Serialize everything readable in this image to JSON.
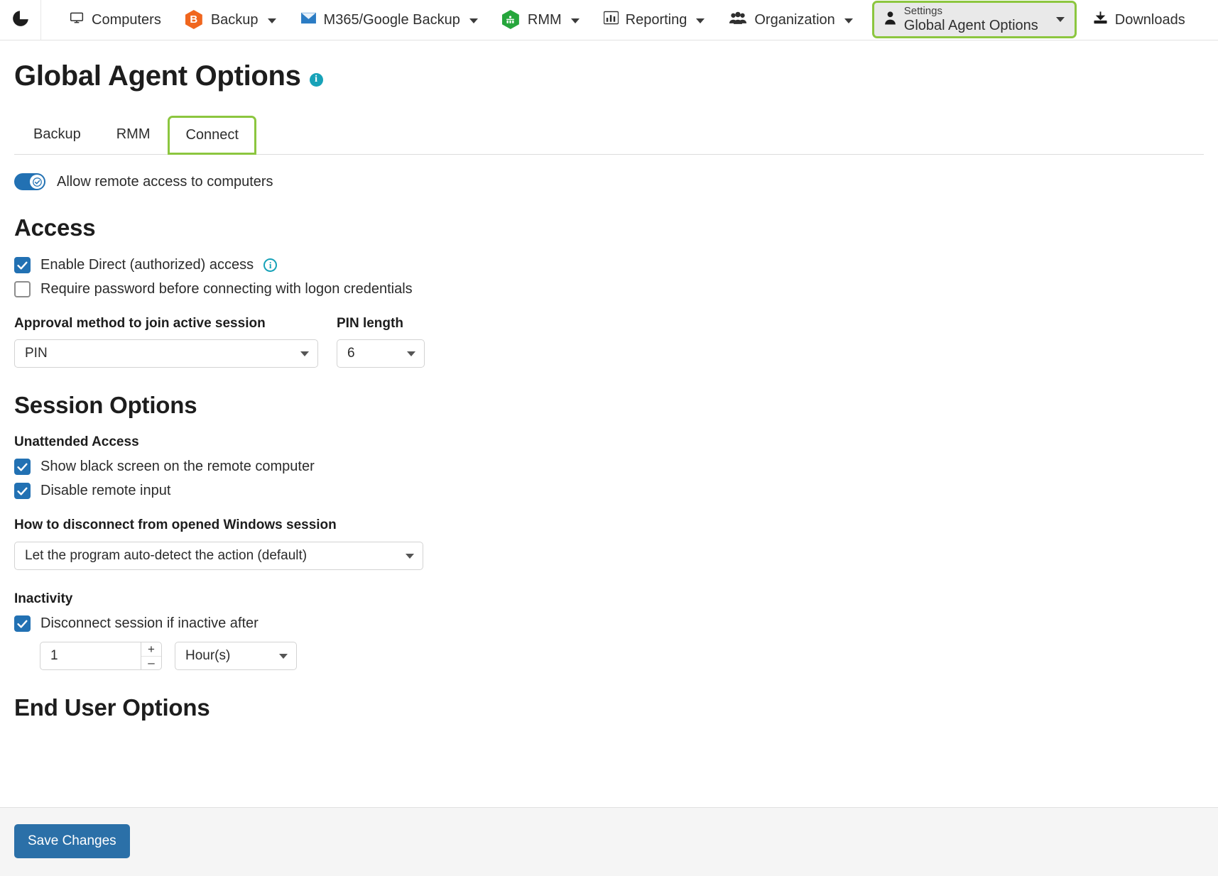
{
  "navbar": {
    "logo_icon": "pie-chart-icon",
    "items": [
      {
        "label": "Computers",
        "icon": "monitor-icon",
        "caret": false
      },
      {
        "label": "Backup",
        "icon": "hex-b-orange-icon",
        "caret": true
      },
      {
        "label": "M365/Google Backup",
        "icon": "envelope-icon",
        "caret": true
      },
      {
        "label": "RMM",
        "icon": "hex-rmm-green-icon",
        "caret": true
      },
      {
        "label": "Reporting",
        "icon": "bar-chart-icon",
        "caret": true
      },
      {
        "label": "Organization",
        "icon": "people-icon",
        "caret": true
      }
    ],
    "settings": {
      "sub_label": "Settings",
      "main_label": "Global Agent Options",
      "icon": "person-icon",
      "caret": true,
      "highlight_color": "#8cc63f"
    },
    "downloads": {
      "label": "Downloads",
      "icon": "download-icon"
    }
  },
  "page": {
    "title": "Global Agent Options",
    "title_info_icon": "info-icon",
    "tabs": [
      {
        "label": "Backup",
        "active": false
      },
      {
        "label": "RMM",
        "active": false
      },
      {
        "label": "Connect",
        "active": true
      }
    ]
  },
  "connect": {
    "master_toggle": {
      "label": "Allow remote access to computers",
      "checked": true
    },
    "access": {
      "heading": "Access",
      "checkboxes": [
        {
          "label": "Enable Direct (authorized) access",
          "checked": true,
          "info": true
        },
        {
          "label": "Require password before connecting with logon credentials",
          "checked": false,
          "info": false
        }
      ],
      "approval_method": {
        "label": "Approval method to join active session",
        "value": "PIN"
      },
      "pin_length": {
        "label": "PIN length",
        "value": "6"
      }
    },
    "session_options": {
      "heading": "Session Options",
      "unattended_access": {
        "label": "Unattended Access",
        "checkboxes": [
          {
            "label": "Show black screen on the remote computer",
            "checked": true
          },
          {
            "label": "Disable remote input",
            "checked": true
          }
        ]
      },
      "disconnect": {
        "label": "How to disconnect from opened Windows session",
        "value": "Let the program auto-detect the action (default)"
      },
      "inactivity": {
        "label": "Inactivity",
        "checkbox": {
          "label": "Disconnect session if inactive after",
          "checked": true
        },
        "amount": "1",
        "unit": "Hour(s)",
        "stepper_up": "+",
        "stepper_down": "–"
      }
    },
    "end_user_options": {
      "heading": "End User Options"
    }
  },
  "footer": {
    "save_label": "Save Changes"
  },
  "colors": {
    "accent_green": "#8cc63f",
    "primary_blue": "#2271b3",
    "button_blue": "#2b70a8",
    "info_teal": "#17a2b8",
    "backup_orange": "#f0661e",
    "rmm_green": "#26a63c"
  }
}
